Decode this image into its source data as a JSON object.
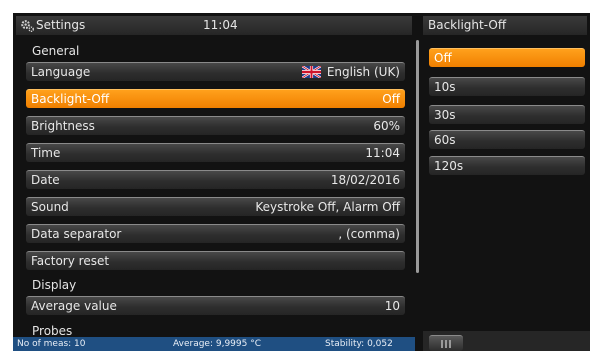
{
  "header": {
    "title": "Settings",
    "time": "11:04",
    "icon": "gear-icon"
  },
  "sections": {
    "general": "General",
    "display": "Display",
    "probes": "Probes"
  },
  "general_items": [
    {
      "label": "Language",
      "value": "English (UK)",
      "icon": "uk-flag-icon"
    },
    {
      "label": "Backlight-Off",
      "value": "Off",
      "selected": true
    },
    {
      "label": "Brightness",
      "value": "60%"
    },
    {
      "label": "Time",
      "value": "11:04"
    },
    {
      "label": "Date",
      "value": "18/02/2016"
    },
    {
      "label": "Sound",
      "value": "Keystroke Off, Alarm Off"
    },
    {
      "label": "Data separator",
      "value": ", (comma)"
    },
    {
      "label": "Factory reset",
      "value": ""
    }
  ],
  "display_items": [
    {
      "label": "Average value",
      "value": "10"
    }
  ],
  "status": {
    "meas": "No of meas: 10",
    "average": "Average: 9,9995 °C",
    "stability": "Stability: 0,052"
  },
  "side_panel": {
    "title": "Backlight-Off",
    "options": [
      "Off",
      "10s",
      "30s",
      "60s",
      "120s"
    ],
    "selected": "Off"
  },
  "colors": {
    "accent": "#f58a00",
    "status_bar": "#1f4f82",
    "background": "#121212"
  }
}
